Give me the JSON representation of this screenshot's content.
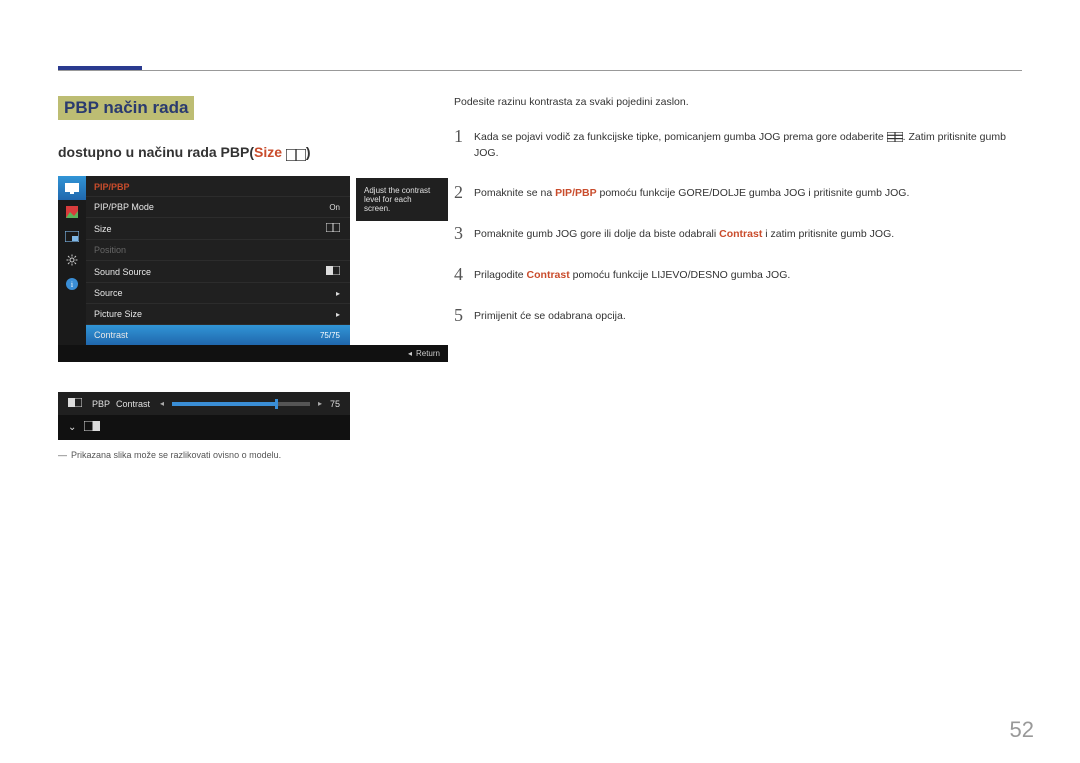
{
  "page_number": "52",
  "heading": "PBP način rada",
  "subhead_prefix": "dostupno u načinu rada PBP(",
  "subhead_size_word": "Size",
  "subhead_suffix": ")",
  "osd": {
    "title": "PIP/PBP",
    "tooltip": "Adjust the contrast level for each screen.",
    "rows": {
      "mode_label": "PIP/PBP Mode",
      "mode_value": "On",
      "size_label": "Size",
      "position_label": "Position",
      "soundsource_label": "Sound Source",
      "source_label": "Source",
      "picturesize_label": "Picture Size",
      "contrast_label": "Contrast",
      "contrast_value": "75/75"
    },
    "return_label": "Return"
  },
  "slider": {
    "mode": "PBP",
    "label": "Contrast",
    "value": "75",
    "percent": 75
  },
  "disclaimer": "Prikazana slika može se razlikovati ovisno o modelu.",
  "intro": "Podesite razinu kontrasta za svaki pojedini zaslon.",
  "steps": {
    "s1a": "Kada se pojavi vodič za funkcijske tipke, pomicanjem gumba JOG prema gore odaberite ",
    "s1b": ". Zatim pritisnite gumb JOG.",
    "s2a": "Pomaknite se na ",
    "s2k": "PIP/PBP",
    "s2b": " pomoću funkcije GORE/DOLJE gumba JOG i pritisnite gumb JOG.",
    "s3a": "Pomaknite gumb JOG gore ili dolje da biste odabrali ",
    "s3k": "Contrast",
    "s3b": " i zatim pritisnite gumb JOG.",
    "s4a": "Prilagodite ",
    "s4k": "Contrast",
    "s4b": " pomoću funkcije LIJEVO/DESNO gumba JOG.",
    "s5": "Primijenit će se odabrana opcija."
  },
  "nums": {
    "n1": "1",
    "n2": "2",
    "n3": "3",
    "n4": "4",
    "n5": "5"
  }
}
